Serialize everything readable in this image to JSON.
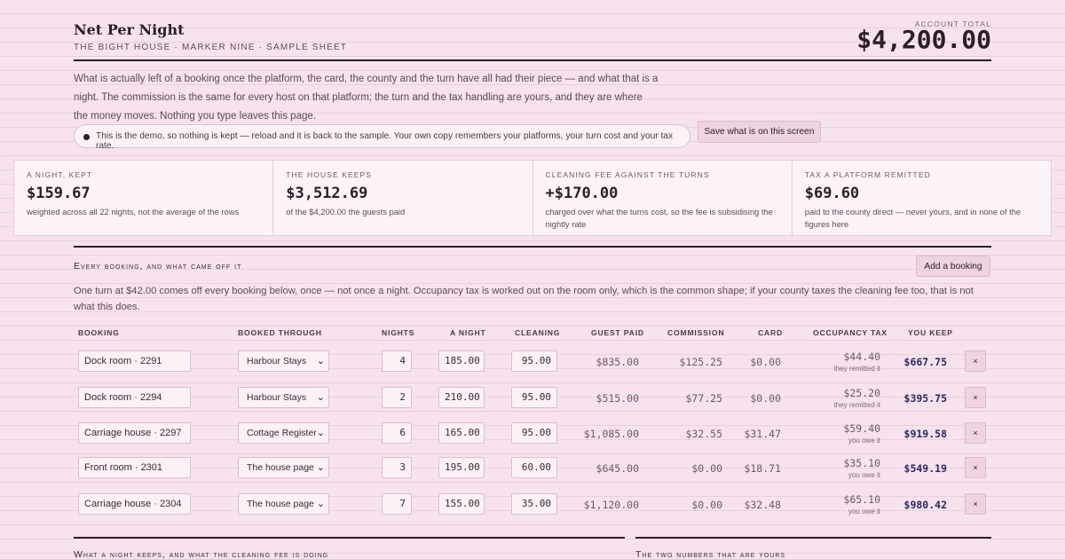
{
  "header": {
    "title": "Net Per Night",
    "subtitle": "THE BIGHT HOUSE · MARKER NINE · SAMPLE SHEET",
    "account_total_label": "ACCOUNT TOTAL",
    "account_total": "$4,200.00"
  },
  "intro": "What is actually left of a booking once the platform, the card, the county and the turn have all had their piece — and what that is a night. The commission is the same for every host on that platform; the turn and the tax handling are yours, and they are where the money moves. Nothing you type leaves this page.",
  "notice": "This is the demo, so nothing is kept — reload and it is back to the sample. Your own copy remembers your platforms, your turn cost and your tax rate.",
  "save_button": "Save what is on this screen",
  "stats": [
    {
      "label": "A NIGHT, KEPT",
      "value": "$159.67",
      "note": "weighted across all 22 nights, not the average of the rows"
    },
    {
      "label": "THE HOUSE KEEPS",
      "value": "$3,512.69",
      "note": "of the $4,200.00 the guests paid"
    },
    {
      "label": "CLEANING FEE AGAINST THE TURNS",
      "value": "+$170.00",
      "note": "charged over what the turns cost, so the fee is subsidising the nightly rate"
    },
    {
      "label": "TAX A PLATFORM REMITTED",
      "value": "$69.60",
      "note": "paid to the county direct — never yours, and in none of the figures here"
    }
  ],
  "bookings_section": {
    "title": "Every booking, and what came off it",
    "add_button": "Add a booking",
    "note": "One turn at $42.00 comes off every booking below, once — not once a night. Occupancy tax is worked out on the room only, which is the common shape; if your county taxes the cleaning fee too, that is not what this does."
  },
  "table": {
    "headers": [
      "BOOKING",
      "BOOKED THROUGH",
      "NIGHTS",
      "A NIGHT",
      "CLEANING",
      "GUEST PAID",
      "COMMISSION",
      "CARD",
      "OCCUPANCY TAX",
      "YOU KEEP"
    ],
    "rows": [
      {
        "booking": "Dock room · 2291",
        "platform": "Harbour Stays",
        "nights": "4",
        "rate": "185.00",
        "cleaning": "95.00",
        "guest_paid": "$835.00",
        "commission": "$125.25",
        "card": "$0.00",
        "tax": "$44.40",
        "tax_who": "they remitted it",
        "keep": "$667.75",
        "delete": "×"
      },
      {
        "booking": "Dock room · 2294",
        "platform": "Harbour Stays",
        "nights": "2",
        "rate": "210.00",
        "cleaning": "95.00",
        "guest_paid": "$515.00",
        "commission": "$77.25",
        "card": "$0.00",
        "tax": "$25.20",
        "tax_who": "they remitted it",
        "keep": "$395.75",
        "delete": "×"
      },
      {
        "booking": "Carriage house · 2297",
        "platform": "Cottage Register",
        "nights": "6",
        "rate": "165.00",
        "cleaning": "95.00",
        "guest_paid": "$1,085.00",
        "commission": "$32.55",
        "card": "$31.47",
        "tax": "$59.40",
        "tax_who": "you owe it",
        "keep": "$919.58",
        "delete": "×"
      },
      {
        "booking": "Front room · 2301",
        "platform": "The house page",
        "nights": "3",
        "rate": "195.00",
        "cleaning": "60.00",
        "guest_paid": "$645.00",
        "commission": "$0.00",
        "card": "$18.71",
        "tax": "$35.10",
        "tax_who": "you owe it",
        "keep": "$549.19",
        "delete": "×"
      },
      {
        "booking": "Carriage house · 2304",
        "platform": "The house page",
        "nights": "7",
        "rate": "155.00",
        "cleaning": "35.00",
        "guest_paid": "$1,120.00",
        "commission": "$0.00",
        "card": "$32.48",
        "tax": "$65.10",
        "tax_who": "you owe it",
        "keep": "$980.42",
        "delete": "×"
      }
    ]
  },
  "bottom_sections": {
    "left_title": "What a night keeps, and what the cleaning fee is doing",
    "right_title": "The two numbers that are yours"
  },
  "icons": {
    "select": "chevron-down-icon",
    "notice": "dot-icon"
  }
}
